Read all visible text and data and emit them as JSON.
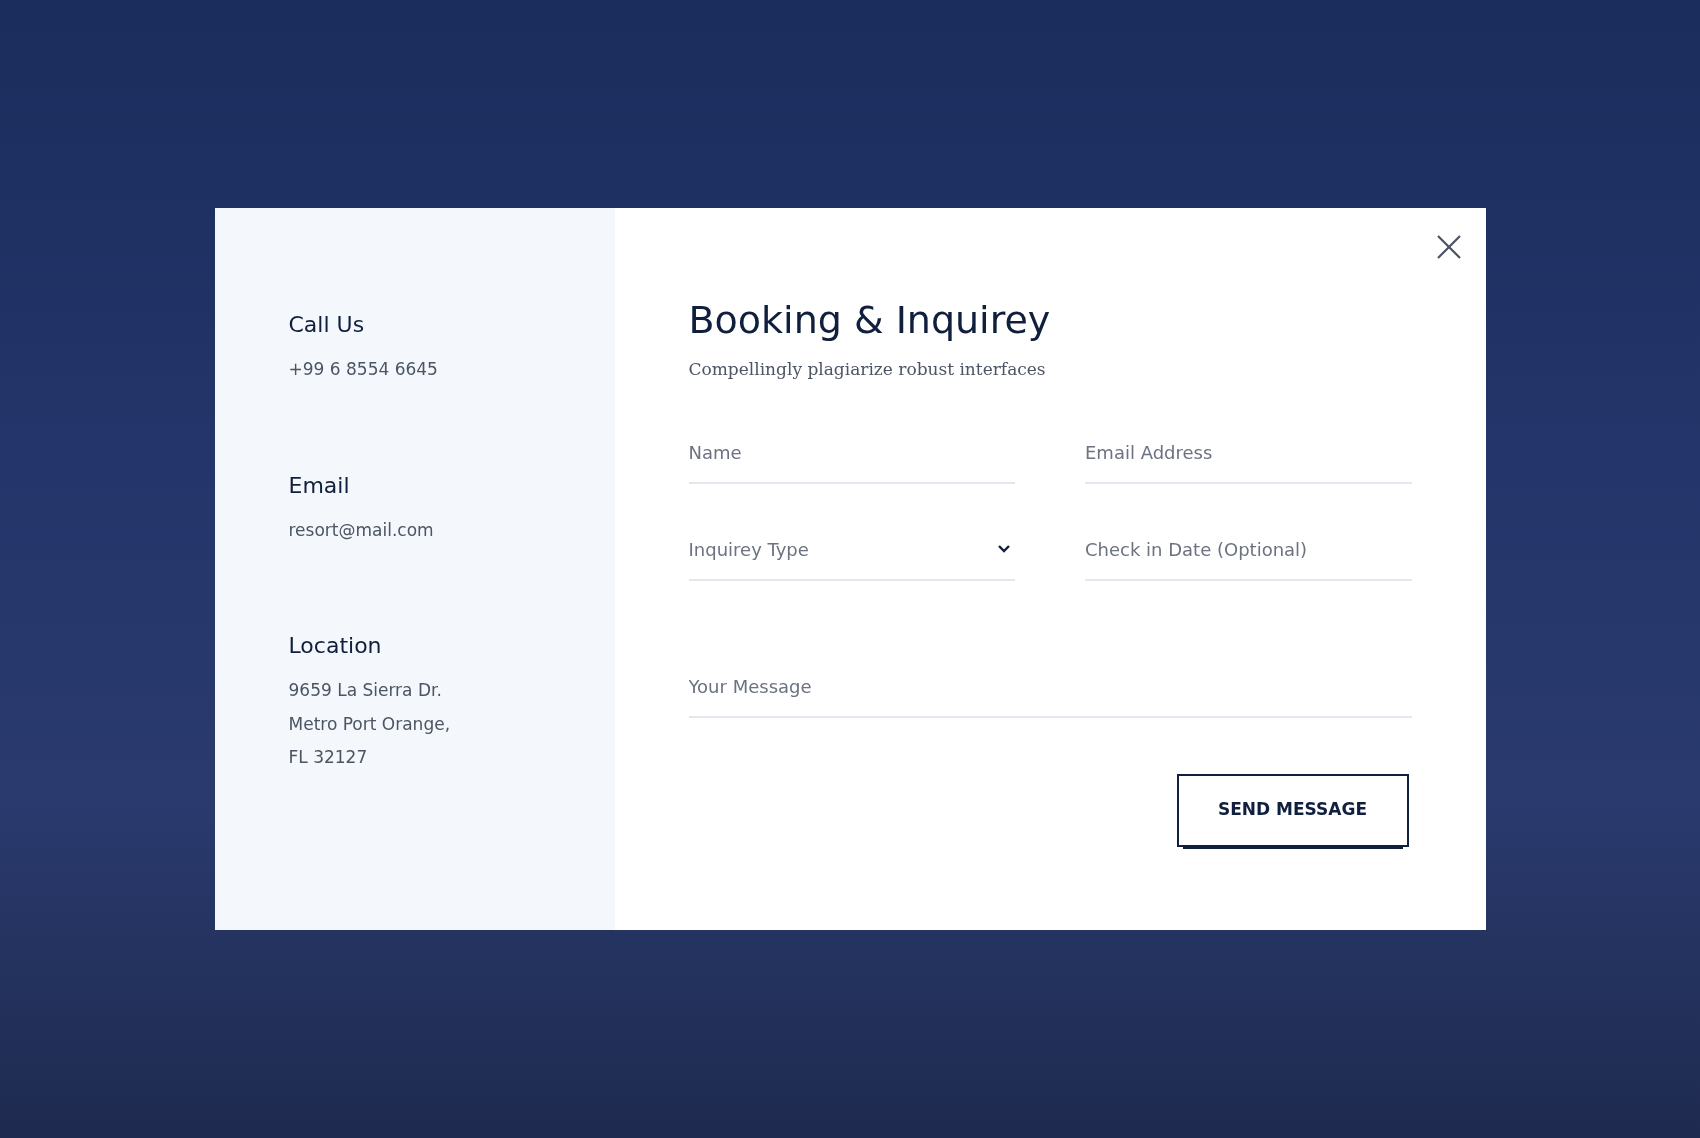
{
  "contact": [
    {
      "heading": "Call Us",
      "lines": [
        "+99 6 8554 6645"
      ]
    },
    {
      "heading": "Email",
      "lines": [
        "resort@mail.com"
      ]
    },
    {
      "heading": "Location",
      "lines": [
        "9659 La Sierra Dr.",
        "Metro Port Orange,",
        "FL 32127"
      ]
    }
  ],
  "form": {
    "title": "Booking & Inquirey",
    "subtitle": "Compellingly plagiarize robust interfaces",
    "fields": [
      {
        "kind": "text",
        "placeholder": "Name"
      },
      {
        "kind": "text",
        "placeholder": "Email Address"
      },
      {
        "kind": "select",
        "placeholder": "Inquirey Type"
      },
      {
        "kind": "text",
        "placeholder": "Check in Date (Optional)"
      },
      {
        "kind": "wide",
        "placeholder": "Your Message"
      }
    ],
    "submit": "SEND MESSAGE"
  }
}
